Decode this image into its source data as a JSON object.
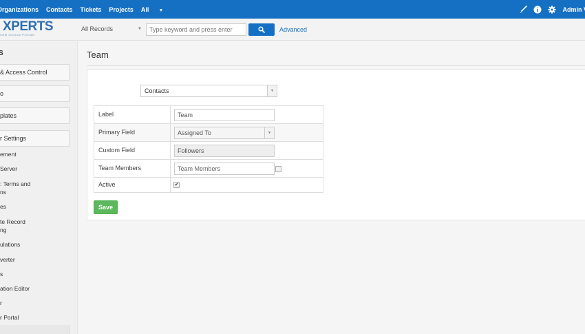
{
  "topnav": {
    "items": [
      "Organizations",
      "Contacts",
      "Tickets",
      "Projects",
      "All"
    ],
    "user": "Admin V",
    "icons": [
      "brush-icon",
      "info-icon",
      "gear-icon"
    ]
  },
  "search": {
    "scope": "All Records",
    "placeholder": "Type keyword and press enter",
    "advanced": "Advanced"
  },
  "logo": {
    "brand_prefix": "",
    "brand": "XPERTS",
    "tagline": "CRM Solution Provider"
  },
  "sidebar": {
    "heading": "S",
    "groups": [
      "& Access Control",
      "o",
      "plates",
      "r Settings"
    ],
    "subitems": [
      "ement",
      "Server",
      ": Terms and",
      "ns",
      "es",
      "te Record",
      "ng",
      "ulations",
      "verter",
      "s",
      "ation Editor",
      "r",
      "r Portal"
    ]
  },
  "page": {
    "title": "Team",
    "module": "Contacts",
    "save_label": "Save",
    "rows": {
      "label": {
        "label": "Label",
        "value": "Team"
      },
      "primary": {
        "label": "Primary Field",
        "value": "Assigned To"
      },
      "custom": {
        "label": "Custom Field",
        "value": "Followers"
      },
      "members": {
        "label": "Team Members",
        "placeholder": "Team Members"
      },
      "active": {
        "label": "Active",
        "checked": true
      }
    }
  },
  "colors": {
    "topbar": "#1570c4",
    "save": "#5cb85c"
  }
}
